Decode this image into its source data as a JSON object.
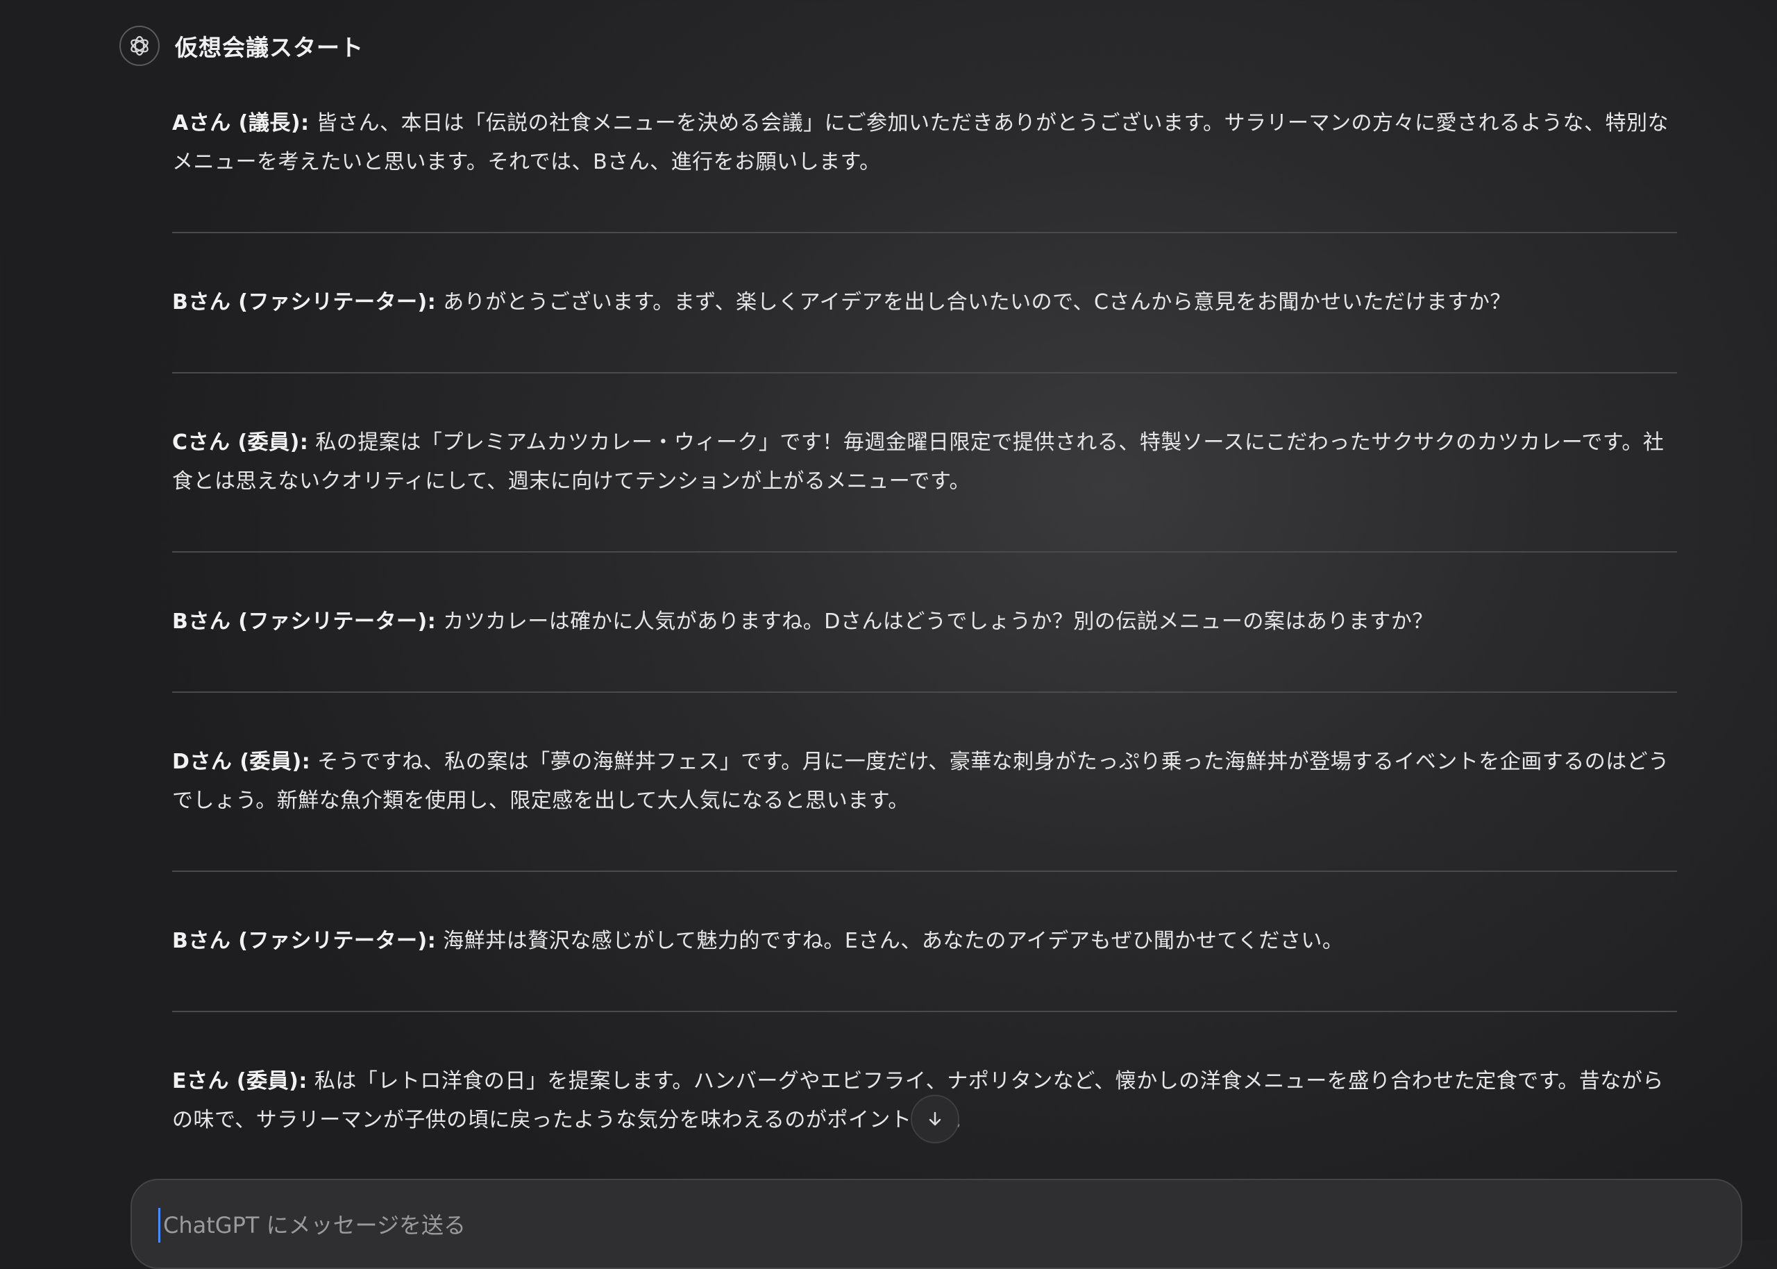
{
  "header": {
    "title": "仮想会議スタート",
    "icon": "openai-logo-icon"
  },
  "messages": [
    {
      "speaker": "Aさん (議長):",
      "text": " 皆さん、本日は「伝説の社食メニューを決める会議」にご参加いただきありがとうございます。サラリーマンの方々に愛されるような、特別なメニューを考えたいと思います。それでは、Bさん、進行をお願いします。"
    },
    {
      "speaker": "Bさん (ファシリテーター):",
      "text": " ありがとうございます。まず、楽しくアイデアを出し合いたいので、Cさんから意見をお聞かせいただけますか？"
    },
    {
      "speaker": "Cさん (委員):",
      "text": " 私の提案は「プレミアムカツカレー・ウィーク」です！毎週金曜日限定で提供される、特製ソースにこだわったサクサクのカツカレーです。社食とは思えないクオリティにして、週末に向けてテンションが上がるメニューです。"
    },
    {
      "speaker": "Bさん (ファシリテーター):",
      "text": " カツカレーは確かに人気がありますね。Dさんはどうでしょうか？別の伝説メニューの案はありますか？"
    },
    {
      "speaker": "Dさん (委員):",
      "text": " そうですね、私の案は「夢の海鮮丼フェス」です。月に一度だけ、豪華な刺身がたっぷり乗った海鮮丼が登場するイベントを企画するのはどうでしょう。新鮮な魚介類を使用し、限定感を出して大人気になると思います。"
    },
    {
      "speaker": "Bさん (ファシリテーター):",
      "text": " 海鮮丼は贅沢な感じがして魅力的ですね。Eさん、あなたのアイデアもぜひ聞かせてください。"
    },
    {
      "speaker": "Eさん (委員):",
      "text": " 私は「レトロ洋食の日」を提案します。ハンバーグやエビフライ、ナポリタンなど、懐かしの洋食メニューを盛り合わせた定食です。昔ながらの味で、サラリーマンが子供の頃に戻ったような気分を味わえるのがポイントです。"
    }
  ],
  "scroll_button": {
    "icon": "arrow-down-icon"
  },
  "composer": {
    "placeholder": "ChatGPT にメッセージを送る",
    "value": ""
  }
}
